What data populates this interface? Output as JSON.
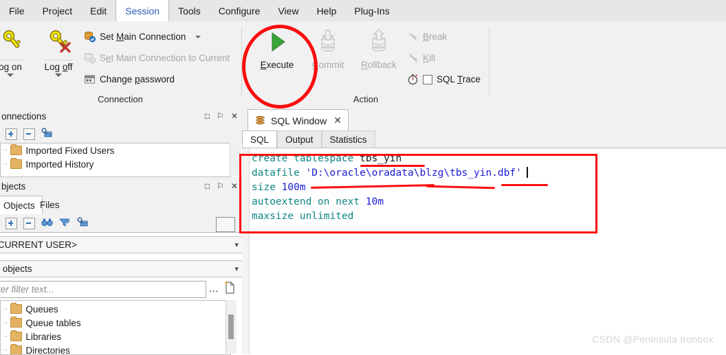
{
  "menubar": {
    "items": [
      {
        "label": "File",
        "active": false
      },
      {
        "label": "Project",
        "active": false
      },
      {
        "label": "Edit",
        "active": false
      },
      {
        "label": "Session",
        "active": true
      },
      {
        "label": "Tools",
        "active": false
      },
      {
        "label": "Configure",
        "active": false
      },
      {
        "label": "View",
        "active": false
      },
      {
        "label": "Help",
        "active": false
      },
      {
        "label": "Plug-Ins",
        "active": false
      }
    ]
  },
  "ribbon": {
    "connection_group": {
      "label": "Connection",
      "logon": "og on",
      "logoff_pre": "Log ",
      "logoff_u": "o",
      "logoff_post": "ff",
      "cmd_set_main_pre": "Set ",
      "cmd_set_main_u": "M",
      "cmd_set_main_post": "ain Connection",
      "cmd_set_main_current_pre": "S",
      "cmd_set_main_current_u": "e",
      "cmd_set_main_current_post": "t Main Connection to Current",
      "cmd_change_pw_pre": "Change ",
      "cmd_change_pw_u": "p",
      "cmd_change_pw_post": "assword"
    },
    "action_group": {
      "label": "Action",
      "execute_u": "E",
      "execute_post": "xecute",
      "commit_u": "C",
      "commit_post": "ommit",
      "rollback_u": "R",
      "rollback_post": "ollback",
      "break_u": "B",
      "break_post": "reak",
      "kill_u": "K",
      "kill_post": "ill",
      "sqltrace_pre": "SQL ",
      "sqltrace_u": "T",
      "sqltrace_post": "race",
      "sqltrace_checked": false
    }
  },
  "connections_panel": {
    "title": "onnections",
    "buttons": {
      "maximize": "□",
      "pin": "⚐",
      "close": "✕"
    },
    "tree": [
      {
        "label": "Imported Fixed Users"
      },
      {
        "label": "Imported History"
      }
    ]
  },
  "objects_panel": {
    "title": "bjects",
    "buttons": {
      "maximize": "□",
      "pin": "⚐",
      "close": "✕"
    },
    "tabs": [
      {
        "label": "Objects",
        "active": true
      },
      {
        "label": "Files",
        "active": false
      }
    ],
    "user_combo": "CURRENT USER>",
    "objects_combo": "l objects",
    "filter_placeholder": "ter filter text...",
    "filter_more": "…",
    "tree": [
      {
        "label": "Queues"
      },
      {
        "label": "Queue tables"
      },
      {
        "label": "Libraries"
      },
      {
        "label": "Directories"
      }
    ]
  },
  "sql_window": {
    "tab_label": "SQL Window",
    "tab_close": "✕",
    "subtabs": [
      {
        "label": "SQL",
        "active": true
      },
      {
        "label": "Output",
        "active": false
      },
      {
        "label": "Statistics",
        "active": false
      }
    ],
    "code_lines": [
      [
        {
          "t": "create tablespace ",
          "c": "kw"
        },
        {
          "t": "tbs_yin",
          "c": "idn"
        }
      ],
      [
        {
          "t": "datafile ",
          "c": "kw"
        },
        {
          "t": "'D:\\oracle\\oradata\\blzg\\tbs_yin.dbf'",
          "c": "str"
        },
        {
          "t": "__CARET__",
          "c": "caret"
        }
      ],
      [
        {
          "t": "size ",
          "c": "kw"
        },
        {
          "t": "100m",
          "c": "num"
        }
      ],
      [
        {
          "t": "autoextend on next ",
          "c": "kw"
        },
        {
          "t": "10m",
          "c": "num"
        }
      ],
      [
        {
          "t": "maxsize unlimited",
          "c": "kw"
        }
      ]
    ]
  },
  "annotations": {
    "circle_target": "execute-button",
    "rect_target": "sql-editor-code"
  },
  "watermark": {
    "text": "CSDN @Peninsula Ironbox"
  },
  "colors": {
    "annotation_red": "#fb0d0d",
    "keyword_teal": "#0f8585",
    "string_blue": "#1a1ad0",
    "active_tab_blue": "#2a5db0",
    "execute_green": "#3aa33a",
    "key_yellow": "#f2e800",
    "folder_orange": "#e3b262"
  }
}
